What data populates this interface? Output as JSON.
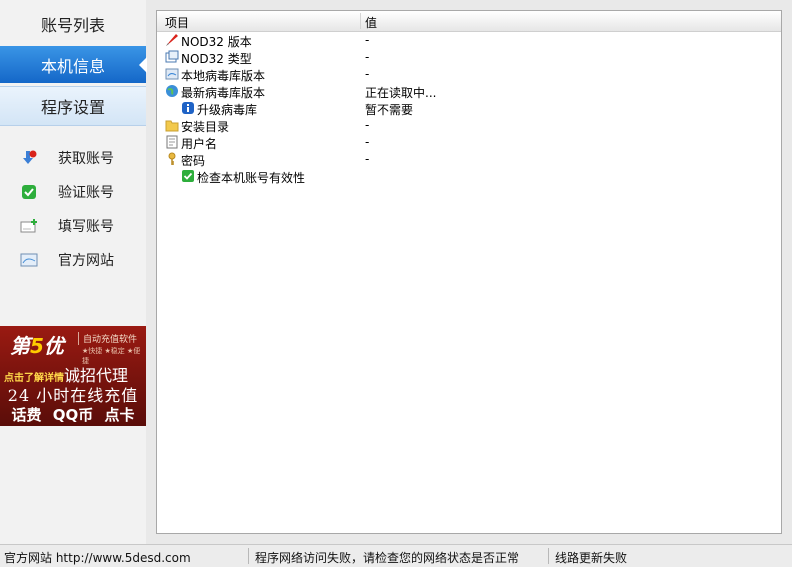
{
  "nav": {
    "items": [
      "账号列表",
      "本机信息",
      "程序设置"
    ]
  },
  "actions": [
    "获取账号",
    "验证账号",
    "填写账号",
    "官方网站"
  ],
  "ad": {
    "brand_a": "第",
    "brand_b": "5",
    "brand_c": "优",
    "soft": "自动充值软件",
    "tags": "★快捷 ★稳定 ★便捷",
    "click": "点击了解详情",
    "recruit": "诚招代理",
    "line2": "24 小时在线充值",
    "line3": "话费 QQ币 点卡"
  },
  "table": {
    "columns": [
      "项目",
      "值"
    ],
    "rows": [
      {
        "name": "NOD32 版本",
        "value": "-",
        "icon": "rocket-icon"
      },
      {
        "name": "NOD32 类型",
        "value": "-",
        "icon": "window-icon"
      },
      {
        "name": "本地病毒库版本",
        "value": "-",
        "icon": "database-icon"
      },
      {
        "name": "最新病毒库版本",
        "value": "正在读取中...",
        "icon": "globe-icon"
      },
      {
        "name": "升级病毒库",
        "value": "暂不需要",
        "icon": "info-icon"
      },
      {
        "name": "安装目录",
        "value": "-",
        "icon": "folder-icon"
      },
      {
        "name": "用户名",
        "value": "-",
        "icon": "user-card-icon"
      },
      {
        "name": "密码",
        "value": "-",
        "icon": "key-icon"
      },
      {
        "name": "检查本机账号有效性",
        "value": "",
        "icon": "check-icon"
      }
    ]
  },
  "status": {
    "site": "官方网站 http://www.5desd.com",
    "error": "程序网络访问失败，请检查您的网络状态是否正常",
    "route": "线路更新失败"
  },
  "colors": {
    "nav_active": "#1d74d6",
    "ad_bg": "#8b1a12"
  }
}
